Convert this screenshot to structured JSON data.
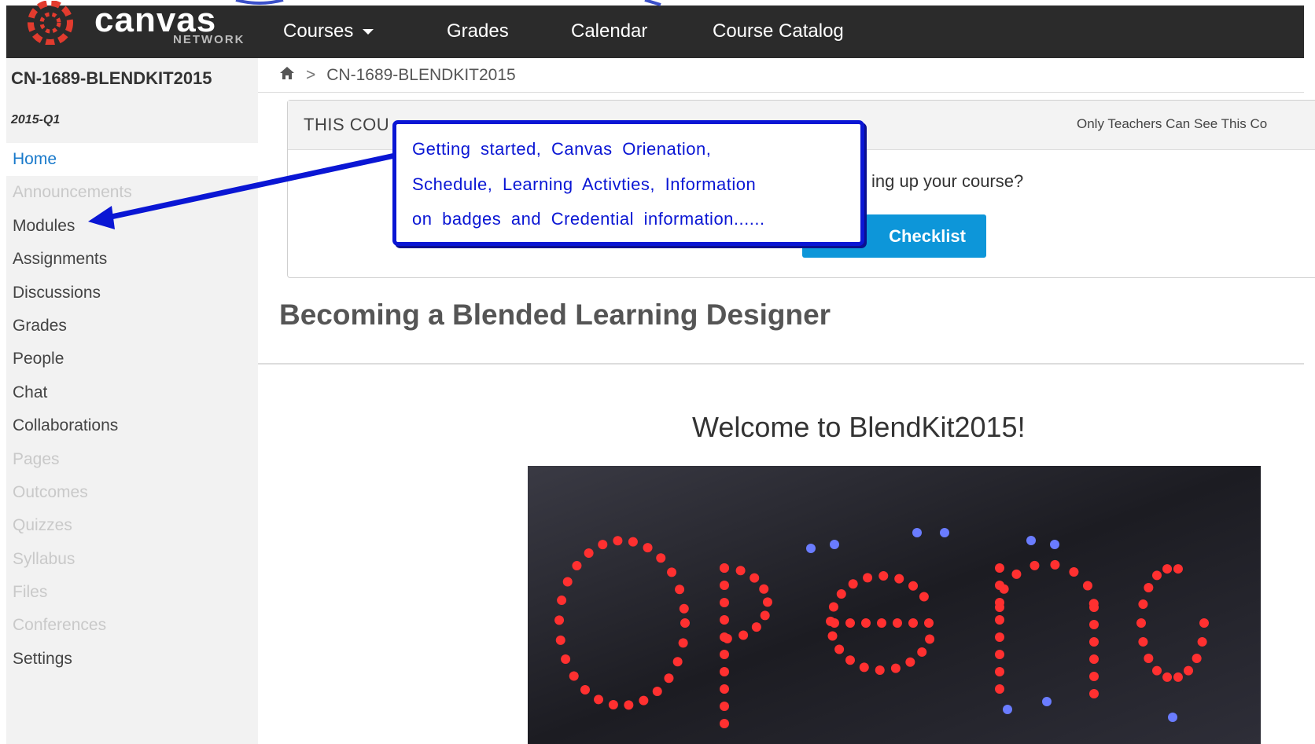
{
  "header": {
    "logo_word": "canvas",
    "logo_sub": "NETWORK",
    "nav": [
      {
        "label": "Courses",
        "has_caret": true
      },
      {
        "label": "Grades"
      },
      {
        "label": "Calendar"
      },
      {
        "label": "Course Catalog"
      }
    ]
  },
  "sidebar": {
    "course_code": "CN-1689-BLENDKIT2015",
    "term": "2015-Q1",
    "items": [
      {
        "label": "Home",
        "state": "active"
      },
      {
        "label": "Announcements",
        "state": "disabled"
      },
      {
        "label": "Modules",
        "state": "normal"
      },
      {
        "label": "Assignments",
        "state": "normal"
      },
      {
        "label": "Discussions",
        "state": "normal"
      },
      {
        "label": "Grades",
        "state": "normal"
      },
      {
        "label": "People",
        "state": "normal"
      },
      {
        "label": "Chat",
        "state": "normal"
      },
      {
        "label": "Collaborations",
        "state": "normal"
      },
      {
        "label": "Pages",
        "state": "disabled"
      },
      {
        "label": "Outcomes",
        "state": "disabled"
      },
      {
        "label": "Quizzes",
        "state": "disabled"
      },
      {
        "label": "Syllabus",
        "state": "disabled"
      },
      {
        "label": "Files",
        "state": "disabled"
      },
      {
        "label": "Conferences",
        "state": "disabled"
      },
      {
        "label": "Settings",
        "state": "normal"
      }
    ]
  },
  "breadcrumb": {
    "current": "CN-1689-BLENDKIT2015"
  },
  "notice": {
    "title": "THIS COU",
    "right_text": "Only Teachers Can See This Co",
    "question": "ing up your course?",
    "button_label": "Checklist"
  },
  "main": {
    "course_heading": "Becoming a Blended Learning Designer",
    "welcome": "Welcome to BlendKit2015!"
  },
  "callout": {
    "lines": [
      "Getting started, Canvas Orienation,",
      "Schedule, Learning Activties, Information",
      "on badges and Credential information......"
    ]
  },
  "colors": {
    "topbar": "#2b2b2b",
    "link_active": "#1a7acb",
    "button": "#0d96d9",
    "annotation": "#0a16d4",
    "logo_red": "#e23b2e"
  }
}
